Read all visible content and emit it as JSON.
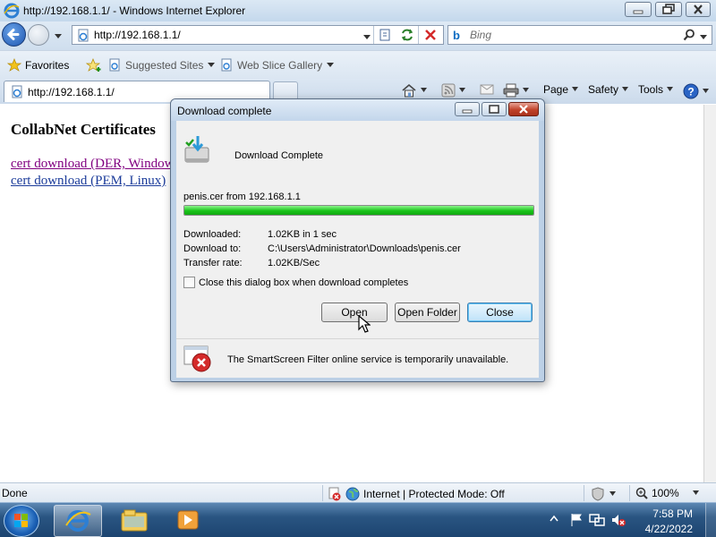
{
  "window": {
    "title": "http://192.168.1.1/ - Windows Internet Explorer"
  },
  "nav": {
    "address": "http://192.168.1.1/",
    "search_placeholder": "Bing"
  },
  "favorites": {
    "favorites_label": "Favorites",
    "suggested_sites": "Suggested Sites",
    "web_slice_gallery": "Web Slice Gallery"
  },
  "tab": {
    "label": "http://192.168.1.1/"
  },
  "commandbar": {
    "page": "Page",
    "safety": "Safety",
    "tools": "Tools"
  },
  "page": {
    "heading": "CollabNet Certificates",
    "links": [
      "cert download (DER, Windows)",
      "cert download (PEM, Linux)"
    ]
  },
  "dialog": {
    "title": "Download complete",
    "heading": "Download Complete",
    "file_line": "penis.cer from 192.168.1.1",
    "progress": 1.0,
    "rows": [
      {
        "label": "Downloaded:",
        "value": "1.02KB in 1 sec"
      },
      {
        "label": "Download to:",
        "value": "C:\\Users\\Administrator\\Downloads\\penis.cer"
      },
      {
        "label": "Transfer rate:",
        "value": "1.02KB/Sec"
      }
    ],
    "checkbox_label": "Close this dialog box when download completes",
    "checkbox_checked": false,
    "buttons": {
      "open": "Open",
      "open_folder": "Open Folder",
      "close": "Close"
    },
    "smartscreen_text": "The SmartScreen Filter online service is temporarily unavailable."
  },
  "statusbar": {
    "status": "Done",
    "zone": "Internet | Protected Mode: Off",
    "zoom": "100%"
  },
  "taskbar": {
    "time": "7:58 PM",
    "date": "4/22/2022"
  },
  "colors": {
    "progress_green": "#19c419",
    "visited_link": "#800080",
    "link": "#1b3b9a",
    "error_red": "#d42a2a"
  }
}
